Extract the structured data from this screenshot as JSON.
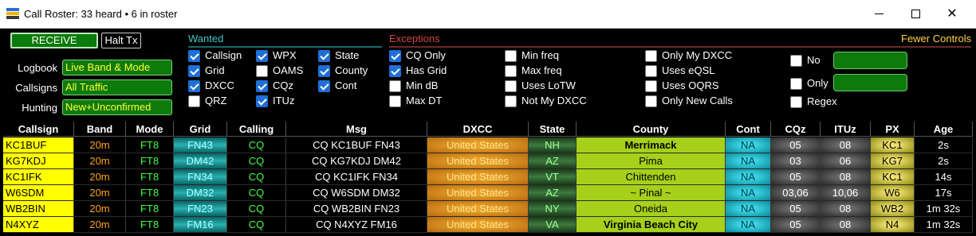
{
  "window": {
    "title": "Call Roster: 33 heard • 6 in roster"
  },
  "controls": {
    "receive_label": "RECEIVE",
    "halt_label": "Halt Tx",
    "logbook_label": "Logbook",
    "logbook_value": "Live Band & Mode",
    "callsigns_label": "Callsigns",
    "callsigns_value": "All Traffic",
    "hunting_label": "Hunting",
    "hunting_value": "New+Unconfirmed"
  },
  "wanted": {
    "title": "Wanted",
    "items": [
      {
        "label": "Callsign",
        "checked": true
      },
      {
        "label": "Grid",
        "checked": true
      },
      {
        "label": "DXCC",
        "checked": true
      },
      {
        "label": "QRZ",
        "checked": false
      },
      {
        "label": "WPX",
        "checked": true
      },
      {
        "label": "OAMS",
        "checked": false
      },
      {
        "label": "CQz",
        "checked": true
      },
      {
        "label": "ITUz",
        "checked": true
      },
      {
        "label": "State",
        "checked": true
      },
      {
        "label": "County",
        "checked": true
      },
      {
        "label": "Cont",
        "checked": true
      }
    ]
  },
  "exceptions": {
    "title": "Exceptions",
    "fewer_controls": "Fewer Controls",
    "items": [
      {
        "label": "CQ Only",
        "checked": true
      },
      {
        "label": "Has Grid",
        "checked": true
      },
      {
        "label": "Min dB",
        "checked": false
      },
      {
        "label": "Max DT",
        "checked": false
      },
      {
        "label": "Min freq",
        "checked": false
      },
      {
        "label": "Max freq",
        "checked": false
      },
      {
        "label": "Uses LoTW",
        "checked": false
      },
      {
        "label": "Not My DXCC",
        "checked": false
      },
      {
        "label": "Only My DXCC",
        "checked": false
      },
      {
        "label": "Uses eQSL",
        "checked": false
      },
      {
        "label": "Uses OQRS",
        "checked": false
      },
      {
        "label": "Only New Calls",
        "checked": false
      },
      {
        "label": "No",
        "checked": false
      },
      {
        "label": "Only",
        "checked": false
      },
      {
        "label": "Regex",
        "checked": false
      }
    ]
  },
  "table": {
    "headers": [
      "Callsign",
      "Band",
      "Mode",
      "Grid",
      "Calling",
      "Msg",
      "DXCC",
      "State",
      "County",
      "Cont",
      "CQz",
      "ITUz",
      "PX",
      "Age"
    ],
    "rows": [
      [
        "KC1BUF",
        "20m",
        "FT8",
        "FN43",
        "CQ",
        "CQ KC1BUF FN43",
        "United States",
        "NH",
        "Merrimack",
        "NA",
        "05",
        "08",
        "KC1",
        "2s"
      ],
      [
        "KG7KDJ",
        "20m",
        "FT8",
        "DM42",
        "CQ",
        "CQ KG7KDJ DM42",
        "United States",
        "AZ",
        "Pima",
        "NA",
        "03",
        "06",
        "KG7",
        "2s"
      ],
      [
        "KC1IFK",
        "20m",
        "FT8",
        "FN34",
        "CQ",
        "CQ KC1IFK FN34",
        "United States",
        "VT",
        "Chittenden",
        "NA",
        "05",
        "08",
        "KC1",
        "14s"
      ],
      [
        "W6SDM",
        "20m",
        "FT8",
        "DM32",
        "CQ",
        "CQ W6SDM DM32",
        "United States",
        "AZ",
        "~ Pinal ~",
        "NA",
        "03,06",
        "10,06",
        "W6",
        "17s"
      ],
      [
        "WB2BIN",
        "20m",
        "FT8",
        "FN23",
        "CQ",
        "CQ WB2BIN FN23",
        "United States",
        "NY",
        "Oneida",
        "NA",
        "05",
        "08",
        "WB2",
        "1m 32s"
      ],
      [
        "N4XYZ",
        "20m",
        "FT8",
        "FM16",
        "CQ",
        "CQ N4XYZ FM16",
        "United States",
        "VA",
        "Virginia Beach City",
        "NA",
        "05",
        "08",
        "N4",
        "1m 32s"
      ]
    ]
  }
}
